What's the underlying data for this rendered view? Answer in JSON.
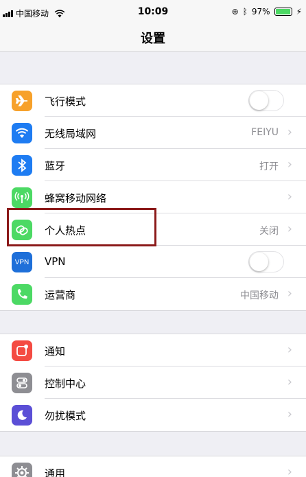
{
  "status_bar": {
    "carrier": "中国移动",
    "time": "10:09",
    "battery": "97%",
    "battery_level": 0.97
  },
  "nav": {
    "title": "设置"
  },
  "groups": [
    {
      "rows": [
        {
          "label": "飞行模式",
          "icon": "airplane-icon",
          "icon_color": "#f7a12a",
          "control": "toggle",
          "toggle_on": false
        },
        {
          "label": "无线局域网",
          "icon": "wifi-icon",
          "icon_color": "#1e7cf2",
          "value": "FEIYU",
          "control": "chevron"
        },
        {
          "label": "蓝牙",
          "icon": "bluetooth-icon",
          "icon_color": "#1e7cf2",
          "value": "打开",
          "control": "chevron"
        },
        {
          "label": "蜂窝移动网络",
          "icon": "cellular-antenna-icon",
          "icon_color": "#4cd964",
          "control": "chevron"
        },
        {
          "label": "个人热点",
          "icon": "hotspot-link-icon",
          "icon_color": "#4cd964",
          "value": "关闭",
          "control": "chevron"
        },
        {
          "label": "VPN",
          "icon": "vpn-icon",
          "icon_color": "#1e6fd9",
          "icon_text": "VPN",
          "control": "toggle",
          "toggle_on": false
        },
        {
          "label": "运营商",
          "icon": "phone-icon",
          "icon_color": "#4cd964",
          "value": "中国移动",
          "control": "chevron"
        }
      ]
    },
    {
      "rows": [
        {
          "label": "通知",
          "icon": "notifications-icon",
          "icon_color": "#f44b42",
          "control": "chevron"
        },
        {
          "label": "控制中心",
          "icon": "control-center-icon",
          "icon_color": "#8e8e93",
          "control": "chevron"
        },
        {
          "label": "勿扰模式",
          "icon": "moon-icon",
          "icon_color": "#5b4fd6",
          "control": "chevron"
        }
      ]
    },
    {
      "rows": [
        {
          "label": "通用",
          "icon": "gear-icon",
          "icon_color": "#8e8e93",
          "control": "chevron"
        }
      ]
    }
  ],
  "highlight_color": "#8b1a1a"
}
